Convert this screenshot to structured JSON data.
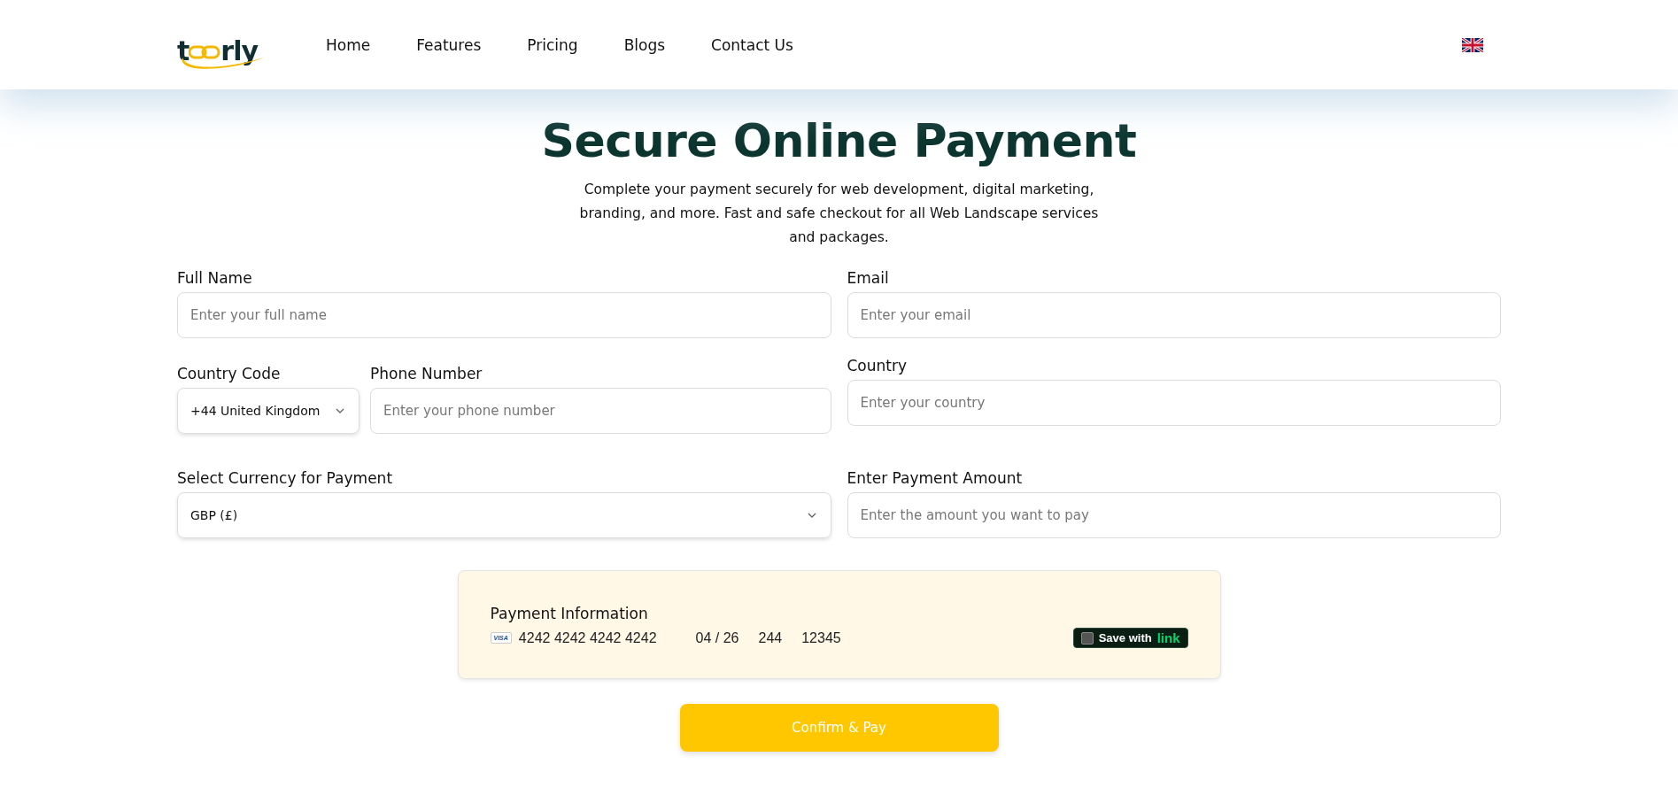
{
  "logo": {
    "start": "t",
    "end": "rly"
  },
  "nav": [
    "Home",
    "Features",
    "Pricing",
    "Blogs",
    "Contact Us"
  ],
  "hero": {
    "title": "Secure Online Payment",
    "subtitle": "Complete your payment securely for web development, digital marketing, branding, and more. Fast and safe checkout for all Web Landscape services and packages."
  },
  "form": {
    "full_name": {
      "label": "Full Name",
      "placeholder": "Enter your full name"
    },
    "email": {
      "label": "Email",
      "placeholder": "Enter your email"
    },
    "country_code": {
      "label": "Country Code",
      "value": "+44 United Kingdom"
    },
    "phone": {
      "label": "Phone Number",
      "placeholder": "Enter your phone number"
    },
    "country": {
      "label": "Country",
      "placeholder": "Enter your country"
    },
    "currency": {
      "label": "Select Currency for Payment",
      "value": "GBP (£)"
    },
    "amount": {
      "label": "Enter Payment Amount",
      "placeholder": "Enter the amount you want to pay"
    }
  },
  "payment": {
    "title": "Payment Information",
    "card_brand": "VISA",
    "card_number": "4242 4242 4242 4242",
    "expiry": "04 / 26",
    "cvc": "244",
    "postal": "12345",
    "save": {
      "label": "Save with",
      "brand": "link",
      "checked": false
    }
  },
  "submit": "Confirm & Pay"
}
